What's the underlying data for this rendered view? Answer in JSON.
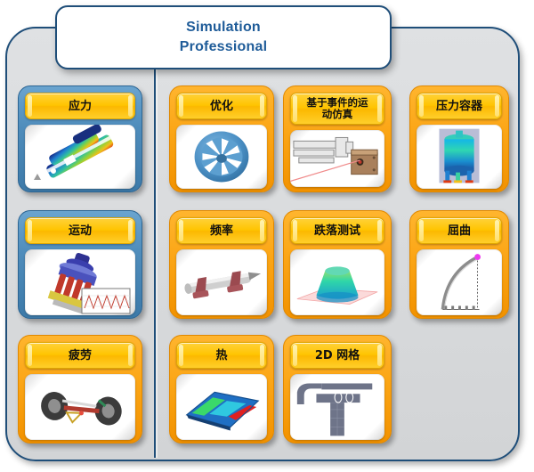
{
  "header": {
    "title_line1": "Simulation",
    "title_line2": "Professional",
    "title_color": "#1f5c99"
  },
  "theme": {
    "panel_border": "#1f4e79",
    "panel_background": "#d8dadc",
    "blue_card_border": "#4e8cbb",
    "orange_card_border": "#fba515",
    "label_bar_color": "#ffc400",
    "label_text_color": "#101010"
  },
  "left_column": {
    "name": "basic-study-column",
    "cards": [
      {
        "label": "应力",
        "accent": "blue",
        "icon": "stress-bracket-contour-icon"
      },
      {
        "label": "运动",
        "accent": "blue",
        "icon": "motion-assembly-plot-icon"
      },
      {
        "label": "疲劳",
        "accent": "orange",
        "icon": "fatigue-suspension-icon"
      }
    ]
  },
  "grid": {
    "name": "advanced-study-grid",
    "rows": [
      [
        {
          "label": "优化",
          "accent": "orange",
          "icon": "optimization-impeller-icon"
        },
        {
          "label": "基于事件的运\n动仿真",
          "accent": "orange",
          "icon": "event-based-motion-actuator-icon",
          "two_line": true
        },
        {
          "label": "压力容器",
          "accent": "orange",
          "icon": "pressure-vessel-tank-icon"
        }
      ],
      [
        {
          "label": "频率",
          "accent": "orange",
          "icon": "frequency-shaft-icon"
        },
        {
          "label": "跌落测试",
          "accent": "orange",
          "icon": "drop-test-dome-icon"
        },
        {
          "label": "屈曲",
          "accent": "orange",
          "icon": "buckling-beam-icon"
        }
      ],
      [
        {
          "label": "热",
          "accent": "orange",
          "icon": "thermal-plate-icon"
        },
        {
          "label": "2D 网格",
          "accent": "orange",
          "icon": "mesh-2d-section-icon"
        }
      ]
    ]
  }
}
